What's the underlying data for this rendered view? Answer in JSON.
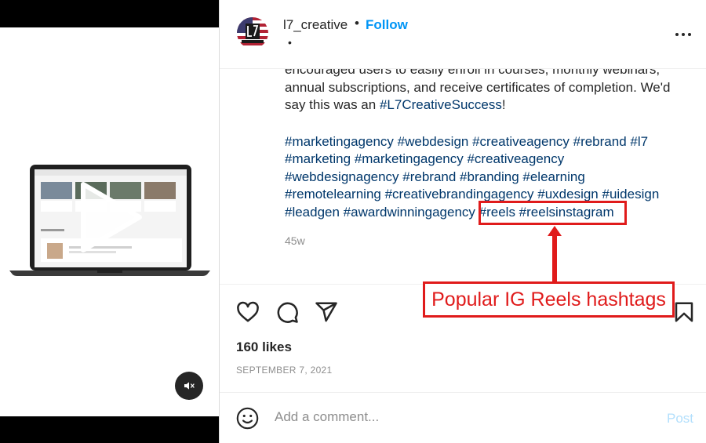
{
  "post": {
    "username": "l7_creative",
    "separator": "•",
    "follow_label": "Follow",
    "sub_dot": "•",
    "caption_lines": [
      "encouraged users to easily enroll in courses, monthly webinars,",
      "annual subscriptions, and receive certificates of completion. We'd",
      "say this was an "
    ],
    "caption_hashtag": "#L7CreativeSuccess",
    "caption_end": "!",
    "hashtag_lines": [
      "#marketingagency #webdesign #creativeagency #rebrand #l7",
      "#marketing #marketingagency #creativeagency",
      "#webdesignagency #rebrand #branding #elearning",
      "#remotelearning #creativebrandingagency #uxdesign #uidesign"
    ],
    "hashtag_last_line": "#leadgen #awardwinningagency ",
    "highlighted_tags": "#reels #reelsinstagram",
    "age": "45w",
    "likes": "160 likes",
    "date": "SEPTEMBER 7, 2021"
  },
  "comment": {
    "placeholder": "Add a comment...",
    "post_label": "Post"
  },
  "annotation": {
    "label": "Popular IG Reels hashtags",
    "color": "#e01b1b"
  },
  "colors": {
    "link": "#0095f6",
    "hashtag": "#00376b",
    "muted": "#8e8e8e"
  }
}
